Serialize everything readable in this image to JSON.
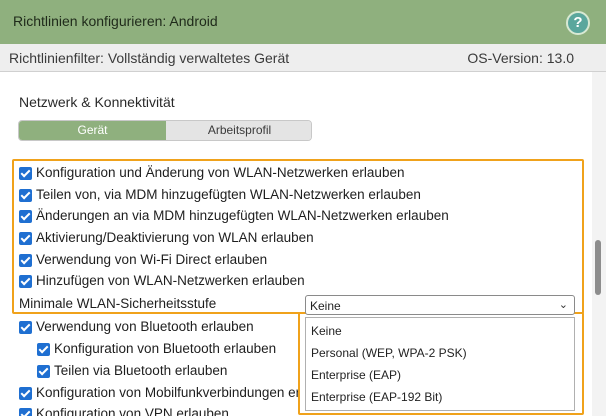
{
  "window": {
    "title": "Richtlinien konfigurieren: Android",
    "help_symbol": "?"
  },
  "filter": {
    "label": "Richtlinienfilter: Vollständig verwaltetes Gerät",
    "os_version": "OS-Version: 13.0"
  },
  "section": {
    "title": "Netzwerk & Konnektivität"
  },
  "tabs": [
    {
      "label": "Gerät",
      "active": true
    },
    {
      "label": "Arbeitsprofil",
      "active": false
    }
  ],
  "settings": [
    {
      "label": "Konfiguration und Änderung von WLAN-Netzwerken erlauben",
      "checked": true
    },
    {
      "label": "Teilen von, via MDM hinzugefügten WLAN-Netzwerken erlauben",
      "checked": true
    },
    {
      "label": "Änderungen an via MDM hinzugefügten WLAN-Netzwerken erlauben",
      "checked": true
    },
    {
      "label": "Aktivierung/Deaktivierung von WLAN erlauben",
      "checked": true
    },
    {
      "label": "Verwendung von Wi-Fi Direct erlauben",
      "checked": true
    },
    {
      "label": "Hinzufügen von WLAN-Netzwerken erlauben",
      "checked": true
    },
    {
      "label": "Minimale WLAN-Sicherheitsstufe"
    },
    {
      "label": "Verwendung von Bluetooth erlauben",
      "checked": true
    },
    {
      "label": "Konfiguration von Bluetooth erlauben",
      "checked": true
    },
    {
      "label": "Teilen via Bluetooth erlauben",
      "checked": true
    },
    {
      "label": "Konfiguration von Mobilfunkverbindungen erl",
      "checked": true
    },
    {
      "label": "Konfiguration von VPN erlauben",
      "checked": true
    }
  ],
  "security_select": {
    "value": "Keine",
    "options": [
      "Keine",
      "Personal (WEP, WPA-2 PSK)",
      "Enterprise (EAP)",
      "Enterprise (EAP-192 Bit)"
    ]
  },
  "colors": {
    "titlebar": "#8fb07e",
    "highlight": "#f0a21b",
    "checkbox": "#1f6fd1",
    "help": "#5ba79d"
  }
}
